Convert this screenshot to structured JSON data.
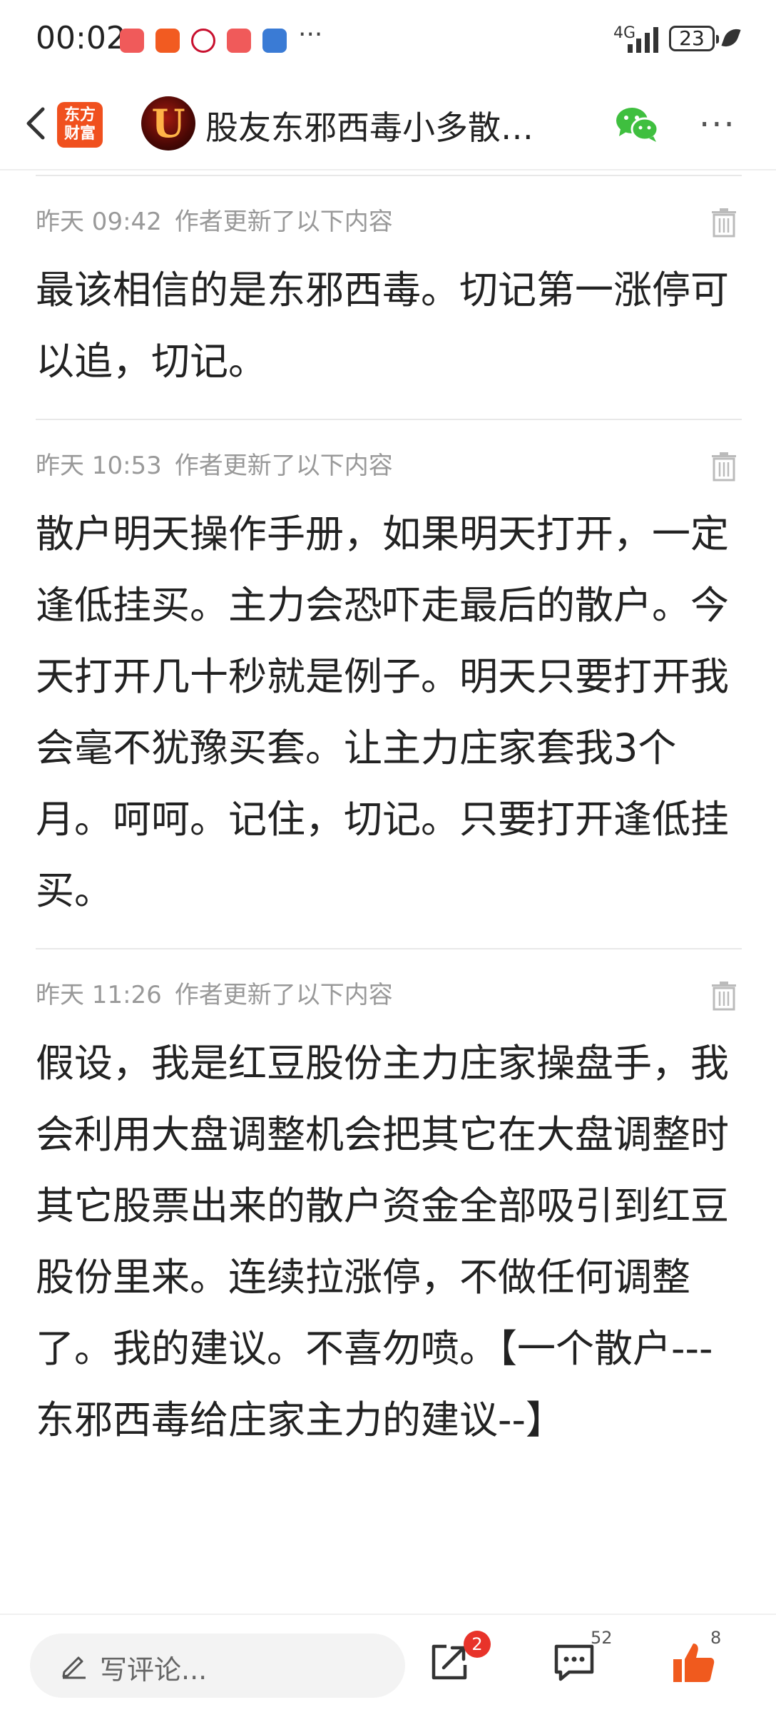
{
  "status_bar": {
    "time": "00:02",
    "network": "4G",
    "battery": "23",
    "overflow": "···"
  },
  "header": {
    "logo_text": "东方财富",
    "avatar_letter": "U",
    "title": "股友东邪西毒小多散…"
  },
  "entries": [
    {
      "time": "昨天 09:42",
      "meta": "作者更新了以下内容",
      "text": "最该相信的是东邪西毒。切记第一涨停可以追，切记。"
    },
    {
      "time": "昨天 10:53",
      "meta": "作者更新了以下内容",
      "text": "散户明天操作手册，如果明天打开，一定逢低挂买。主力会恐吓走最后的散户。今天打开几十秒就是例子。明天只要打开我会毫不犹豫买套。让主力庄家套我3个月。呵呵。记住，切记。只要打开逢低挂买。"
    },
    {
      "time": "昨天 11:26",
      "meta": "作者更新了以下内容",
      "text": "假设，我是红豆股份主力庄家操盘手，我会利用大盘调整机会把其它在大盘调整时其它股票出来的散户资金全部吸引到红豆股份里来。连续拉涨停，不做任何调整了。我的建议。不喜勿喷。【一个散户---东邪西毒给庄家主力的建议--】"
    }
  ],
  "bottom_bar": {
    "comment_placeholder": "写评论...",
    "share_badge": "2",
    "comment_count": "52",
    "like_count": "8"
  },
  "colors": {
    "accent_orange": "#f0501e",
    "badge_red": "#e8332a",
    "wechat_green": "#3fbf3f",
    "like_orange": "#f05a1e"
  },
  "icons": [
    "back-arrow-icon",
    "wechat-icon",
    "more-icon",
    "trash-icon",
    "pen-icon",
    "share-icon",
    "comment-icon",
    "like-icon"
  ]
}
